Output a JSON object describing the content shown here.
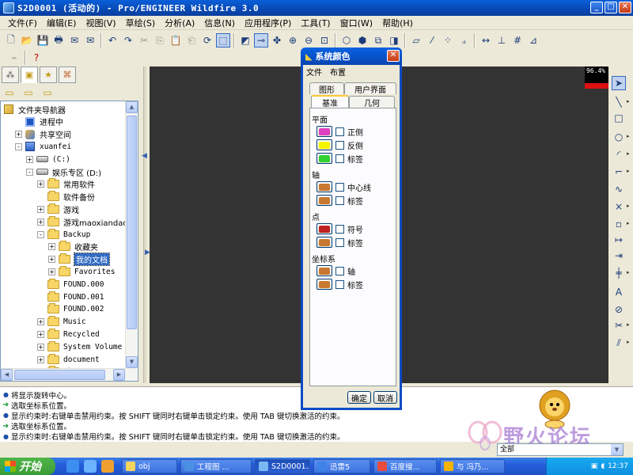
{
  "window": {
    "title": "S2D0001 (活动的) - Pro/ENGINEER Wildfire 3.0"
  },
  "menubar": {
    "items": [
      "文件(F)",
      "编辑(E)",
      "视图(V)",
      "草绘(S)",
      "分析(A)",
      "信息(N)",
      "应用程序(P)",
      "工具(T)",
      "窗口(W)",
      "帮助(H)"
    ]
  },
  "navigator": {
    "rows": [
      {
        "label": "文件夹导航器",
        "indent": 0,
        "icon": "navigator",
        "exp": ""
      },
      {
        "label": "进程中",
        "indent": 1,
        "icon": "session",
        "exp": ""
      },
      {
        "label": "共享空间",
        "indent": 1,
        "icon": "shared",
        "exp": "+"
      },
      {
        "label": "xuanfei",
        "indent": 1,
        "icon": "computer",
        "exp": "-"
      },
      {
        "label": "(C:)",
        "indent": 2,
        "icon": "drive",
        "exp": "+"
      },
      {
        "label": "娱乐专区 (D:)",
        "indent": 2,
        "icon": "drive",
        "exp": "-"
      },
      {
        "label": "常用软件",
        "indent": 3,
        "icon": "folder",
        "exp": "+"
      },
      {
        "label": "软件备份",
        "indent": 3,
        "icon": "folder",
        "exp": ""
      },
      {
        "label": "游戏",
        "indent": 3,
        "icon": "folder",
        "exp": "+"
      },
      {
        "label": "游戏maoxiandao",
        "indent": 3,
        "icon": "folder",
        "exp": "+"
      },
      {
        "label": "Backup",
        "indent": 3,
        "icon": "folder",
        "exp": "-"
      },
      {
        "label": "收藏夹",
        "indent": 4,
        "icon": "folder",
        "exp": "+"
      },
      {
        "label": "我的文档",
        "indent": 4,
        "icon": "folder",
        "exp": "+",
        "selected": true
      },
      {
        "label": "Favorites",
        "indent": 4,
        "icon": "folder",
        "exp": "+"
      },
      {
        "label": "FOUND.000",
        "indent": 3,
        "icon": "folder",
        "exp": ""
      },
      {
        "label": "FOUND.001",
        "indent": 3,
        "icon": "folder",
        "exp": ""
      },
      {
        "label": "FOUND.002",
        "indent": 3,
        "icon": "folder",
        "exp": ""
      },
      {
        "label": "Music",
        "indent": 3,
        "icon": "folder",
        "exp": "+"
      },
      {
        "label": "Recycled",
        "indent": 3,
        "icon": "folder",
        "exp": "+"
      },
      {
        "label": "System Volume Infor",
        "indent": 3,
        "icon": "folder",
        "exp": "+"
      },
      {
        "label": "document",
        "indent": 3,
        "icon": "folder",
        "exp": "+"
      },
      {
        "label": "ghost",
        "indent": 3,
        "icon": "folder",
        "exp": "+"
      }
    ]
  },
  "perf": {
    "value": "96.4%",
    "fraction": 0.5
  },
  "messages": [
    {
      "kind": "info",
      "text": "将显示旋转中心。"
    },
    {
      "kind": "prompt",
      "text": "选取坐标系位置。"
    },
    {
      "kind": "info",
      "text": "显示约束时:右键单击禁用约束。按 SHIFT 键同时右键单击锁定约束。使用 TAB 键切换激活的约束。"
    },
    {
      "kind": "prompt",
      "text": "选取坐标系位置。"
    },
    {
      "kind": "info",
      "text": "显示约束时:右键单击禁用约束。按 SHIFT 键同时右键单击锁定约束。使用 TAB 键切换激活的约束。"
    }
  ],
  "filter": {
    "value": "全部"
  },
  "watermark": {
    "text": "野火论坛"
  },
  "taskbar": {
    "start": "开始",
    "tasks": [
      {
        "label": "obj",
        "color": "#f4d35e"
      },
      {
        "label": "工程图 ...",
        "color": "#4a90e2"
      },
      {
        "label": "S2D0001...",
        "color": "#7ab8f5",
        "active": true
      },
      {
        "label": "迅雷5",
        "color": "#3f83e8"
      },
      {
        "label": "百度搜...",
        "color": "#e94b3c"
      },
      {
        "label": "与 冯乃...",
        "color": "#f4b400"
      }
    ],
    "clock": "12:37"
  },
  "dialog": {
    "title": "系统颜色",
    "menu": [
      "文件",
      "布置"
    ],
    "tabs_back": [
      "图形",
      "用户界面"
    ],
    "tabs_front": [
      "基准",
      "几何"
    ],
    "groups": [
      {
        "title": "平面",
        "items": [
          {
            "label": "正侧",
            "color": "#e040c0"
          },
          {
            "label": "反侧",
            "color": "#f5f500"
          },
          {
            "label": "标签",
            "color": "#30d030"
          }
        ]
      },
      {
        "title": "轴",
        "items": [
          {
            "label": "中心线",
            "color": "#c87830"
          },
          {
            "label": "标签",
            "color": "#c87830"
          }
        ]
      },
      {
        "title": "点",
        "items": [
          {
            "label": "符号",
            "color": "#c02020"
          },
          {
            "label": "标签",
            "color": "#c87830"
          }
        ]
      },
      {
        "title": "坐标系",
        "items": [
          {
            "label": "轴",
            "color": "#c87830"
          },
          {
            "label": "标签",
            "color": "#c87830"
          }
        ]
      }
    ],
    "ok": "确定",
    "cancel": "取消"
  }
}
